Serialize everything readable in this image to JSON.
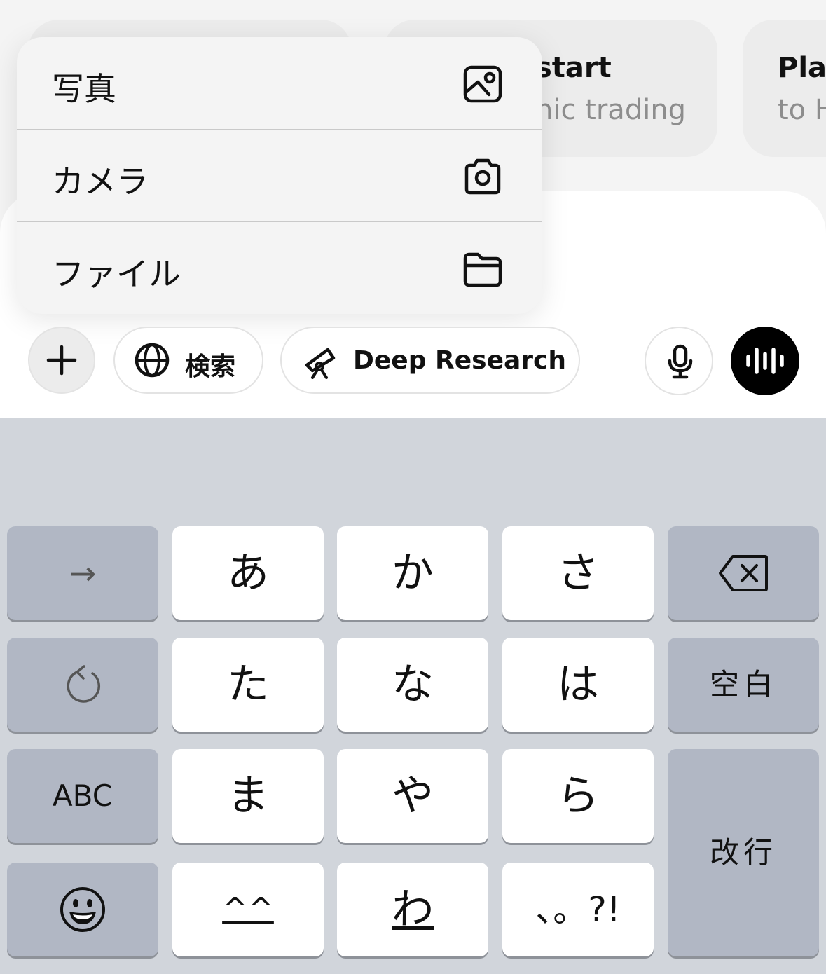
{
  "suggestions": [
    {
      "title": "",
      "subtitle": ""
    },
    {
      "title": "start",
      "subtitle": "nic trading"
    },
    {
      "title": "Pla",
      "subtitle": "to H"
    }
  ],
  "attach_menu": {
    "items": [
      {
        "label": "写真",
        "icon": "photo-icon"
      },
      {
        "label": "カメラ",
        "icon": "camera-icon"
      },
      {
        "label": "ファイル",
        "icon": "folder-icon"
      }
    ]
  },
  "toolbar": {
    "search_label": "検索",
    "research_label": "Deep Research"
  },
  "keyboard": {
    "rows": [
      [
        "→",
        "あ",
        "か",
        "さ",
        "delete"
      ],
      [
        "undo",
        "た",
        "な",
        "は",
        "空白"
      ],
      [
        "ABC",
        "ま",
        "や",
        "ら",
        "改行"
      ],
      [
        "emoji",
        "^^",
        "わ",
        "、。?!"
      ]
    ]
  },
  "colors": {
    "keyboard_bg": "#d1d5db",
    "key_light": "#ffffff",
    "key_dark": "#b1b7c4",
    "voice_button": "#000000"
  }
}
